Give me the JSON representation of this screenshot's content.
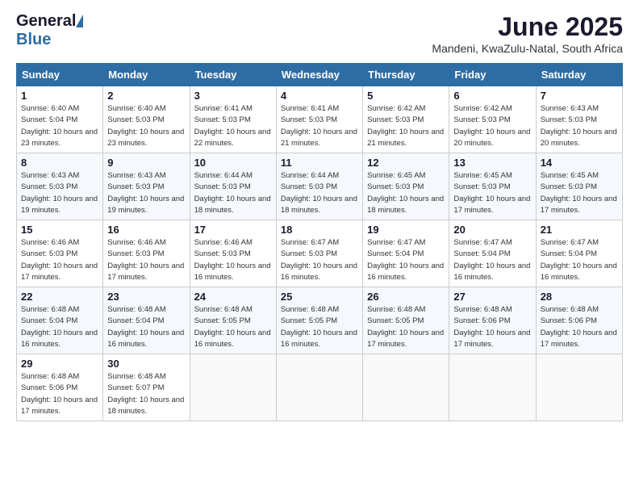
{
  "header": {
    "logo_general": "General",
    "logo_blue": "Blue",
    "month_title": "June 2025",
    "location": "Mandeni, KwaZulu-Natal, South Africa"
  },
  "days_of_week": [
    "Sunday",
    "Monday",
    "Tuesday",
    "Wednesday",
    "Thursday",
    "Friday",
    "Saturday"
  ],
  "weeks": [
    [
      {
        "day": "1",
        "sunrise": "Sunrise: 6:40 AM",
        "sunset": "Sunset: 5:04 PM",
        "daylight": "Daylight: 10 hours and 23 minutes."
      },
      {
        "day": "2",
        "sunrise": "Sunrise: 6:40 AM",
        "sunset": "Sunset: 5:03 PM",
        "daylight": "Daylight: 10 hours and 23 minutes."
      },
      {
        "day": "3",
        "sunrise": "Sunrise: 6:41 AM",
        "sunset": "Sunset: 5:03 PM",
        "daylight": "Daylight: 10 hours and 22 minutes."
      },
      {
        "day": "4",
        "sunrise": "Sunrise: 6:41 AM",
        "sunset": "Sunset: 5:03 PM",
        "daylight": "Daylight: 10 hours and 21 minutes."
      },
      {
        "day": "5",
        "sunrise": "Sunrise: 6:42 AM",
        "sunset": "Sunset: 5:03 PM",
        "daylight": "Daylight: 10 hours and 21 minutes."
      },
      {
        "day": "6",
        "sunrise": "Sunrise: 6:42 AM",
        "sunset": "Sunset: 5:03 PM",
        "daylight": "Daylight: 10 hours and 20 minutes."
      },
      {
        "day": "7",
        "sunrise": "Sunrise: 6:43 AM",
        "sunset": "Sunset: 5:03 PM",
        "daylight": "Daylight: 10 hours and 20 minutes."
      }
    ],
    [
      {
        "day": "8",
        "sunrise": "Sunrise: 6:43 AM",
        "sunset": "Sunset: 5:03 PM",
        "daylight": "Daylight: 10 hours and 19 minutes."
      },
      {
        "day": "9",
        "sunrise": "Sunrise: 6:43 AM",
        "sunset": "Sunset: 5:03 PM",
        "daylight": "Daylight: 10 hours and 19 minutes."
      },
      {
        "day": "10",
        "sunrise": "Sunrise: 6:44 AM",
        "sunset": "Sunset: 5:03 PM",
        "daylight": "Daylight: 10 hours and 18 minutes."
      },
      {
        "day": "11",
        "sunrise": "Sunrise: 6:44 AM",
        "sunset": "Sunset: 5:03 PM",
        "daylight": "Daylight: 10 hours and 18 minutes."
      },
      {
        "day": "12",
        "sunrise": "Sunrise: 6:45 AM",
        "sunset": "Sunset: 5:03 PM",
        "daylight": "Daylight: 10 hours and 18 minutes."
      },
      {
        "day": "13",
        "sunrise": "Sunrise: 6:45 AM",
        "sunset": "Sunset: 5:03 PM",
        "daylight": "Daylight: 10 hours and 17 minutes."
      },
      {
        "day": "14",
        "sunrise": "Sunrise: 6:45 AM",
        "sunset": "Sunset: 5:03 PM",
        "daylight": "Daylight: 10 hours and 17 minutes."
      }
    ],
    [
      {
        "day": "15",
        "sunrise": "Sunrise: 6:46 AM",
        "sunset": "Sunset: 5:03 PM",
        "daylight": "Daylight: 10 hours and 17 minutes."
      },
      {
        "day": "16",
        "sunrise": "Sunrise: 6:46 AM",
        "sunset": "Sunset: 5:03 PM",
        "daylight": "Daylight: 10 hours and 17 minutes."
      },
      {
        "day": "17",
        "sunrise": "Sunrise: 6:46 AM",
        "sunset": "Sunset: 5:03 PM",
        "daylight": "Daylight: 10 hours and 16 minutes."
      },
      {
        "day": "18",
        "sunrise": "Sunrise: 6:47 AM",
        "sunset": "Sunset: 5:03 PM",
        "daylight": "Daylight: 10 hours and 16 minutes."
      },
      {
        "day": "19",
        "sunrise": "Sunrise: 6:47 AM",
        "sunset": "Sunset: 5:04 PM",
        "daylight": "Daylight: 10 hours and 16 minutes."
      },
      {
        "day": "20",
        "sunrise": "Sunrise: 6:47 AM",
        "sunset": "Sunset: 5:04 PM",
        "daylight": "Daylight: 10 hours and 16 minutes."
      },
      {
        "day": "21",
        "sunrise": "Sunrise: 6:47 AM",
        "sunset": "Sunset: 5:04 PM",
        "daylight": "Daylight: 10 hours and 16 minutes."
      }
    ],
    [
      {
        "day": "22",
        "sunrise": "Sunrise: 6:48 AM",
        "sunset": "Sunset: 5:04 PM",
        "daylight": "Daylight: 10 hours and 16 minutes."
      },
      {
        "day": "23",
        "sunrise": "Sunrise: 6:48 AM",
        "sunset": "Sunset: 5:04 PM",
        "daylight": "Daylight: 10 hours and 16 minutes."
      },
      {
        "day": "24",
        "sunrise": "Sunrise: 6:48 AM",
        "sunset": "Sunset: 5:05 PM",
        "daylight": "Daylight: 10 hours and 16 minutes."
      },
      {
        "day": "25",
        "sunrise": "Sunrise: 6:48 AM",
        "sunset": "Sunset: 5:05 PM",
        "daylight": "Daylight: 10 hours and 16 minutes."
      },
      {
        "day": "26",
        "sunrise": "Sunrise: 6:48 AM",
        "sunset": "Sunset: 5:05 PM",
        "daylight": "Daylight: 10 hours and 17 minutes."
      },
      {
        "day": "27",
        "sunrise": "Sunrise: 6:48 AM",
        "sunset": "Sunset: 5:06 PM",
        "daylight": "Daylight: 10 hours and 17 minutes."
      },
      {
        "day": "28",
        "sunrise": "Sunrise: 6:48 AM",
        "sunset": "Sunset: 5:06 PM",
        "daylight": "Daylight: 10 hours and 17 minutes."
      }
    ],
    [
      {
        "day": "29",
        "sunrise": "Sunrise: 6:48 AM",
        "sunset": "Sunset: 5:06 PM",
        "daylight": "Daylight: 10 hours and 17 minutes."
      },
      {
        "day": "30",
        "sunrise": "Sunrise: 6:48 AM",
        "sunset": "Sunset: 5:07 PM",
        "daylight": "Daylight: 10 hours and 18 minutes."
      },
      {
        "day": "",
        "sunrise": "",
        "sunset": "",
        "daylight": ""
      },
      {
        "day": "",
        "sunrise": "",
        "sunset": "",
        "daylight": ""
      },
      {
        "day": "",
        "sunrise": "",
        "sunset": "",
        "daylight": ""
      },
      {
        "day": "",
        "sunrise": "",
        "sunset": "",
        "daylight": ""
      },
      {
        "day": "",
        "sunrise": "",
        "sunset": "",
        "daylight": ""
      }
    ]
  ]
}
